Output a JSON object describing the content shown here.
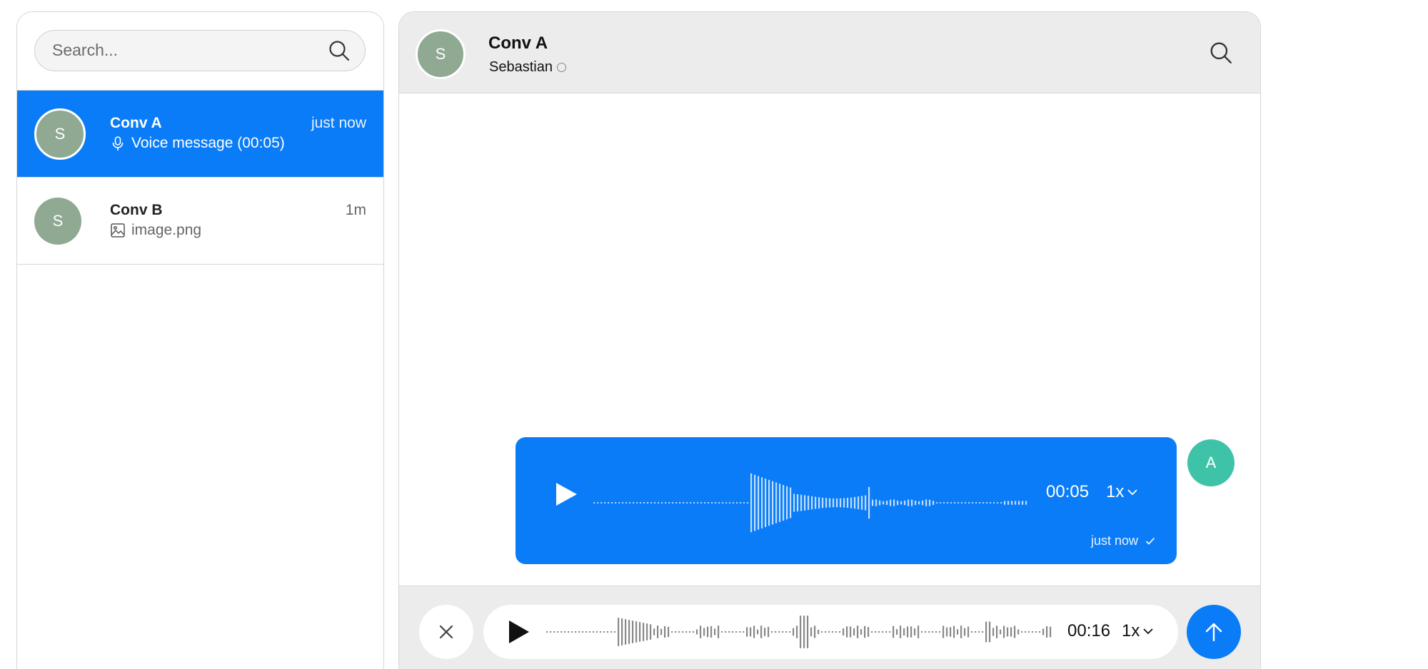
{
  "search": {
    "placeholder": "Search..."
  },
  "conversations": [
    {
      "name": "Conv A",
      "time": "just now",
      "preview": "Voice message (00:05)",
      "preview_icon": "microphone-icon",
      "avatar_initial": "S",
      "active": true
    },
    {
      "name": "Conv B",
      "time": "1m",
      "preview": "image.png",
      "preview_icon": "image-icon",
      "avatar_initial": "S",
      "active": false
    }
  ],
  "chat": {
    "title": "Conv A",
    "participant": "Sebastian",
    "avatar_initial": "S"
  },
  "message": {
    "duration": "00:05",
    "speed": "1x",
    "time": "just now",
    "sender_initial": "A"
  },
  "composer": {
    "duration": "00:16",
    "speed": "1x"
  },
  "colors": {
    "accent": "#0a7cf8",
    "contact_avatar": "#8fa993",
    "self_avatar": "#3fc3a8"
  }
}
